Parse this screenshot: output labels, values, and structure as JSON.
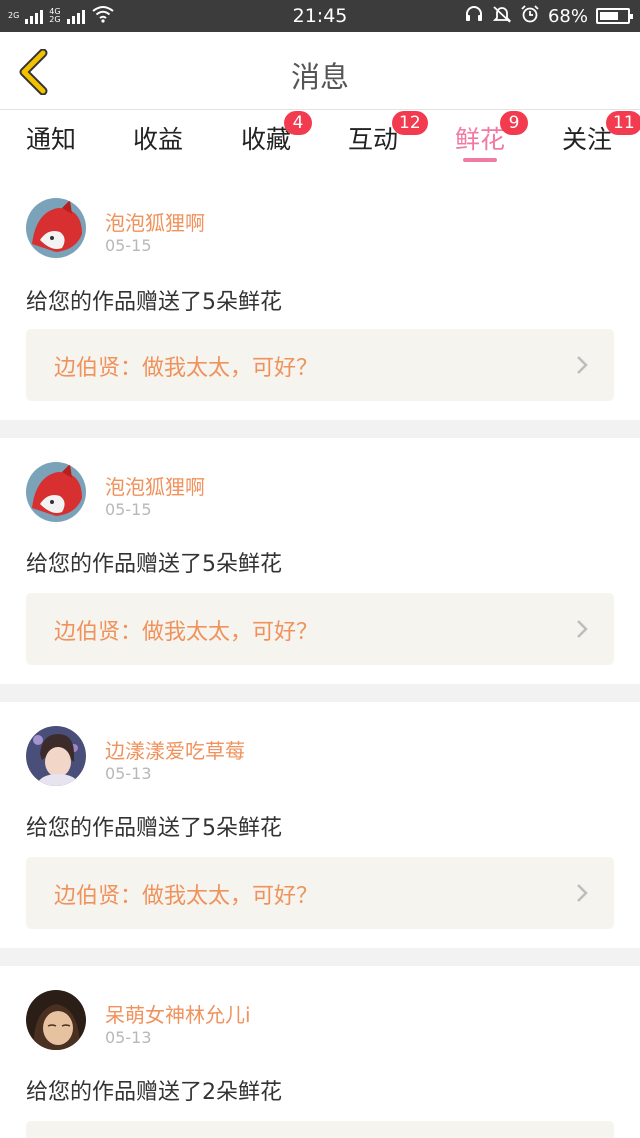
{
  "status_bar": {
    "net1": "2G",
    "net2a": "4G",
    "net2b": "2G",
    "time": "21:45",
    "battery_pct": "68%",
    "battery_level": 0.68,
    "icons": [
      "headset-icon",
      "mute-icon",
      "alarm-icon",
      "battery-icon",
      "wifi-icon",
      "signal-icon"
    ]
  },
  "header": {
    "title": "消息"
  },
  "tabs": [
    {
      "label": "通知",
      "badge": ""
    },
    {
      "label": "收益",
      "badge": ""
    },
    {
      "label": "收藏",
      "badge": "4"
    },
    {
      "label": "互动",
      "badge": "12"
    },
    {
      "label": "鲜花",
      "badge": "9",
      "active": true
    },
    {
      "label": "关注",
      "badge": "11"
    }
  ],
  "items": [
    {
      "user": "泡泡狐狸啊",
      "date": "05-15",
      "message": "给您的作品赠送了5朵鲜花",
      "quote": "边伯贤：做我太太，可好？",
      "avatar_icon": "fox-avatar"
    },
    {
      "user": "泡泡狐狸啊",
      "date": "05-15",
      "message": "给您的作品赠送了5朵鲜花",
      "quote": "边伯贤：做我太太，可好？",
      "avatar_icon": "fox-avatar"
    },
    {
      "user": "边漾漾爱吃草莓",
      "date": "05-13",
      "message": "给您的作品赠送了5朵鲜花",
      "quote": "边伯贤：做我太太，可好？",
      "avatar_icon": "person-avatar"
    },
    {
      "user": "呆萌女神林允儿i",
      "date": "05-13",
      "message": "给您的作品赠送了2朵鲜花",
      "avatar_icon": "person-avatar"
    }
  ],
  "colors": {
    "accent": "#f07aa3",
    "username": "#f0925c",
    "badge": "#f23b4f",
    "back_arrow": "#f2c200",
    "quote_bg": "#f5f4ef"
  }
}
